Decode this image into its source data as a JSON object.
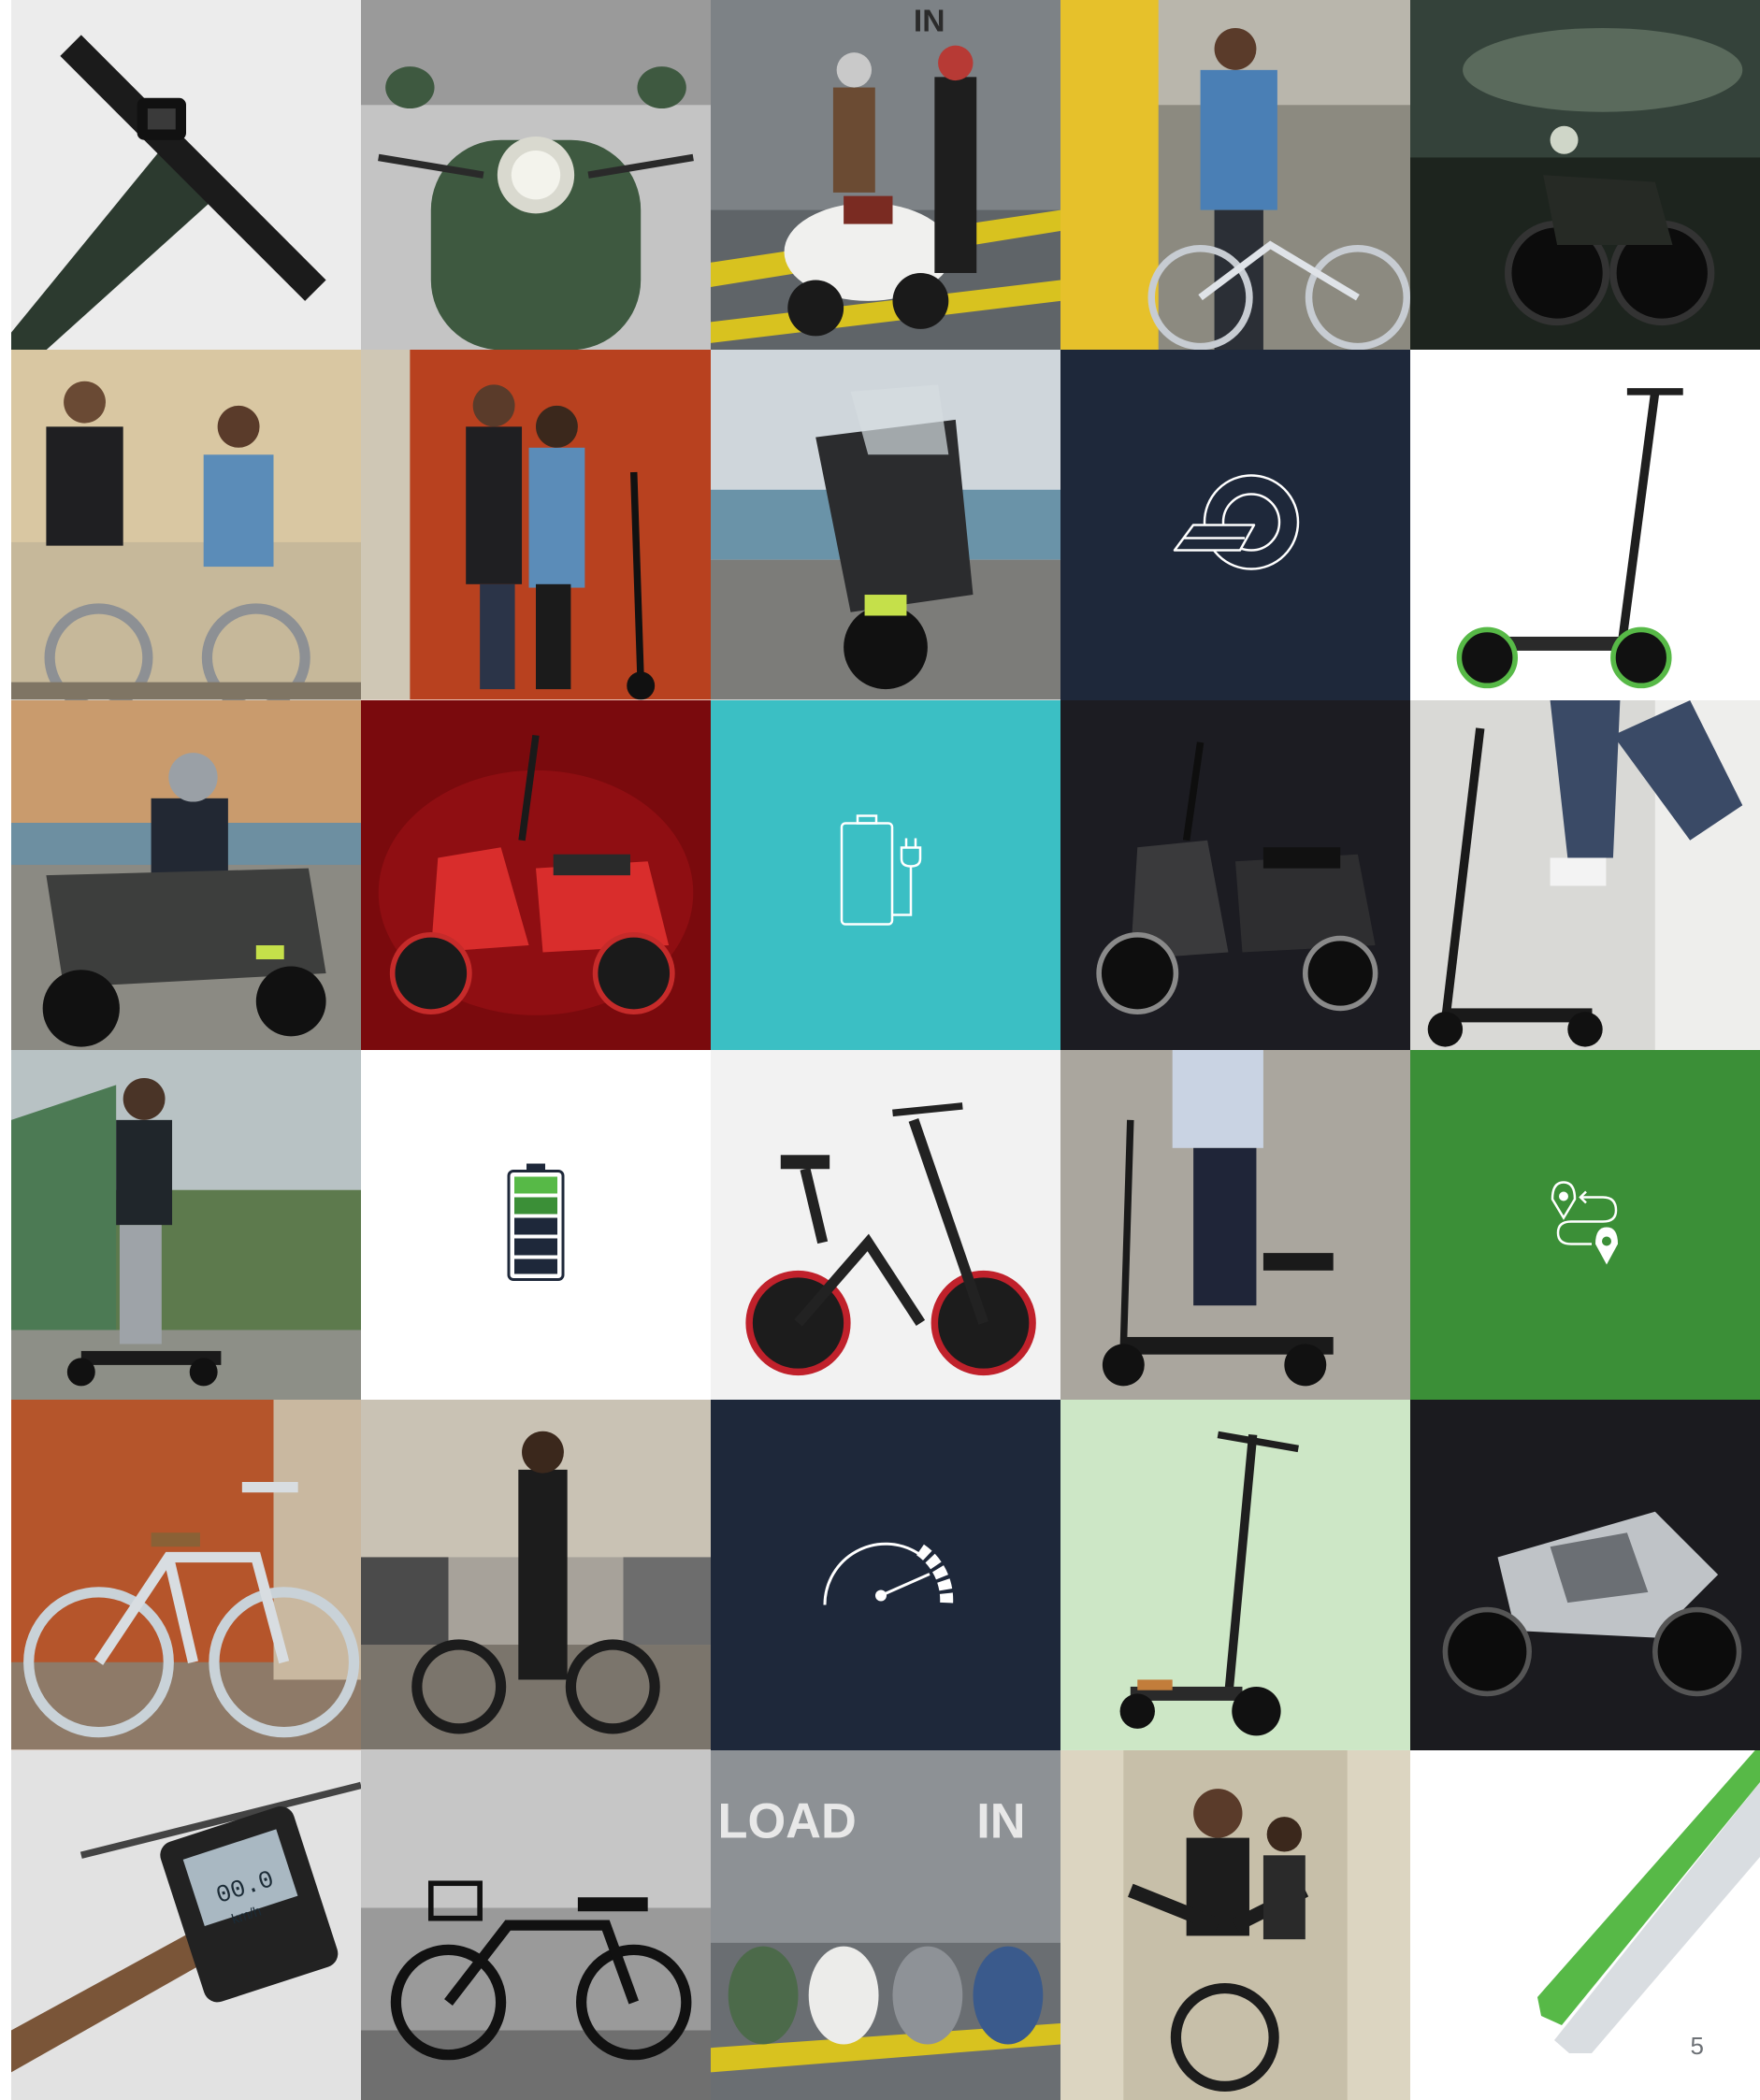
{
  "page": {
    "number": "5"
  },
  "colors": {
    "navy": "#1e283a",
    "teal": "#3bbfc4",
    "green": "#3b8f37",
    "brand_green": "#57b947",
    "light_gray": "#d9dde1",
    "red_backdrop": "#8a0c0f",
    "mint": "#cfe8c9",
    "dark_tile": "#1c1c22"
  },
  "grid": {
    "columns": 5,
    "rows": 6,
    "tiles": [
      {
        "kind": "photo",
        "subject": "handlebar-display"
      },
      {
        "kind": "photo",
        "subject": "green-scooter-headlight"
      },
      {
        "kind": "photo",
        "subject": "couple-with-white-scooter"
      },
      {
        "kind": "photo",
        "subject": "woman-with-bike"
      },
      {
        "kind": "photo",
        "subject": "motorbike-night"
      },
      {
        "kind": "photo",
        "subject": "couple-with-bikes"
      },
      {
        "kind": "photo",
        "subject": "couple-with-escooters"
      },
      {
        "kind": "photo",
        "subject": "maxi-scooter-sea"
      },
      {
        "kind": "icon",
        "icon": "brand-logo-icon"
      },
      {
        "kind": "photo",
        "subject": "escooter-product"
      },
      {
        "kind": "photo",
        "subject": "rider-on-maxi-scooter"
      },
      {
        "kind": "photo",
        "subject": "red-scooter"
      },
      {
        "kind": "icon",
        "icon": "charging-battery-icon"
      },
      {
        "kind": "photo",
        "subject": "black-scooter"
      },
      {
        "kind": "photo",
        "subject": "escooter-rider-legs"
      },
      {
        "kind": "photo",
        "subject": "man-on-three-wheel-scooter"
      },
      {
        "kind": "icon",
        "icon": "battery-level-icon",
        "level": 0.4
      },
      {
        "kind": "photo",
        "subject": "folding-ebike"
      },
      {
        "kind": "photo",
        "subject": "seated-scooter"
      },
      {
        "kind": "icon",
        "icon": "route-icon"
      },
      {
        "kind": "photo",
        "subject": "city-bike-orange-wall"
      },
      {
        "kind": "photo",
        "subject": "woman-with-ebike-street"
      },
      {
        "kind": "icon",
        "icon": "speedometer-icon"
      },
      {
        "kind": "photo",
        "subject": "three-wheel-escooter-product"
      },
      {
        "kind": "photo",
        "subject": "sport-motorbike"
      },
      {
        "kind": "photo",
        "subject": "ebike-display-closeup"
      },
      {
        "kind": "photo",
        "subject": "black-city-ebike"
      },
      {
        "kind": "photo",
        "subject": "four-scooters-lineup"
      },
      {
        "kind": "photo",
        "subject": "women-riding-ebikes"
      },
      {
        "kind": "blank",
        "subject": "corner-stripes"
      }
    ]
  },
  "photo_signage": {
    "loading_door_left": "LOAD",
    "loading_door_right": "IN",
    "door_top": "IN",
    "display_speed": "00.0",
    "display_unit": "km/h"
  }
}
